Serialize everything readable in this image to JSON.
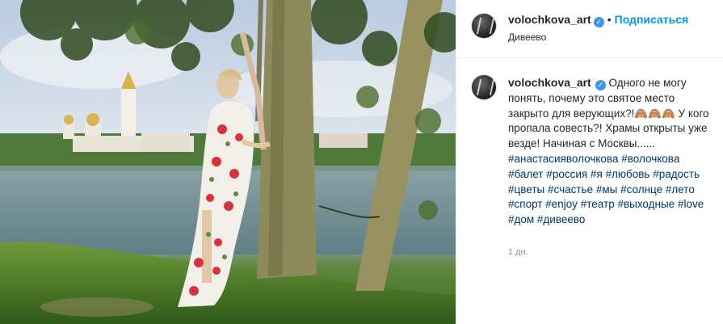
{
  "post": {
    "username": "volochkova_art",
    "verified": true,
    "separator": "•",
    "follow_label": "Подписаться",
    "location": "Дивеево",
    "caption_text": "Одного не могу понять, почему это святое место закрыто для верующих?!🙈🙈🙈 У кого пропала совесть?! Храмы открыты уже везде! Начиная с Москвы......",
    "hashtags": "#анастасияволочкова #волочкова #балет #россия #я #любовь #радость #цветы #счастье #мы #солнце #лето #спорт #enjoy #театр #выходные #love #дом #дивеево",
    "time_ago": "1 дн."
  },
  "photo": {
    "subject": "woman in floral dress leaning against a tree by a lake with a monastery in the background",
    "colors": {
      "sky": "#cfdce9",
      "water": "#7d989c",
      "grass": "#4a7a26",
      "dress": "#f1efe8",
      "flowers": "#d8323c"
    }
  },
  "icons": {
    "verified": "verified-badge-icon",
    "avatar": "avatar"
  }
}
